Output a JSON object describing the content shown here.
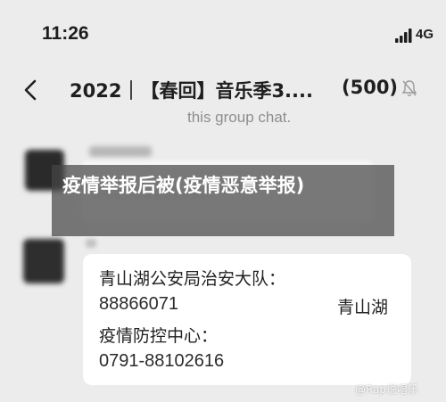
{
  "status_bar": {
    "time": "11:26",
    "network": "4G",
    "signal_icon": "signal-bars-icon"
  },
  "nav": {
    "back_icon": "chevron-left-icon",
    "title": "2022｜【春回】音乐季3....",
    "member_count": "(500)",
    "mute_icon": "bell-muted-icon"
  },
  "system_message": "this group chat.",
  "overlay": {
    "headline": "疫情举报后被(疫情恶意举报)"
  },
  "message": {
    "line1": "青山湖公安局治安大队：",
    "line2": "88866071",
    "line2_right": "青山湖",
    "line3": "疫情防控中心：",
    "line4": "0791-88102616"
  },
  "watermark": "@Rap说唱乐",
  "colors": {
    "background": "#ececec",
    "bubble": "#ffffff",
    "overlay": "#464646"
  }
}
